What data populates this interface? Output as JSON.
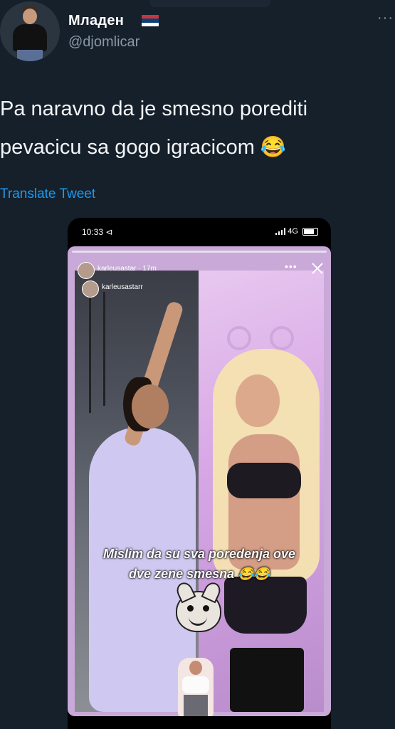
{
  "tweet": {
    "author": {
      "display_name": "Младен",
      "flag_icon": "serbia-flag-icon",
      "flag_colors": [
        "#c6363c",
        "#0c4076",
        "#ffffff"
      ],
      "handle": "@djomlicar"
    },
    "text_line1": "Pa naravno da je smesno porediti",
    "text_line2": "pevacicu sa gogo igracicom 😂",
    "translate_label": "Translate Tweet",
    "more_icon": "more-options-icon"
  },
  "phone": {
    "status_time": "10:33 ⊲",
    "status_network": "4G",
    "story": {
      "username_1": "karleusastar · 17m",
      "username_2": "karleusastarr",
      "caption_line1": "Mislim da su sva poredenja ove",
      "caption_line2": "dve zene smesna 😂😂"
    }
  },
  "colors": {
    "background": "#15202b",
    "link": "#1d9bf0",
    "handle": "#8b98a5"
  }
}
